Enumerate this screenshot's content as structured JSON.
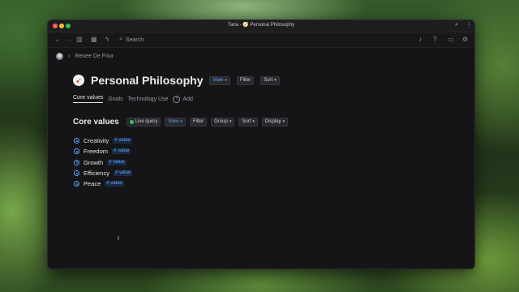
{
  "window": {
    "title": "Tana - 🧭 Personal Philosophy"
  },
  "toolbar": {
    "search_placeholder": "Search"
  },
  "breadcrumb": {
    "user": "Renee De Four"
  },
  "page": {
    "title": "Personal Philosophy",
    "chips": {
      "view": "View",
      "filter": "Filter",
      "sort": "Sort"
    }
  },
  "tabs": {
    "core": "Core values",
    "goals": "Goals",
    "tech": "Technology Use",
    "add": "Add"
  },
  "section": {
    "title": "Core values",
    "live": "Live query",
    "view": "View",
    "filter": "Filter",
    "group": "Group",
    "sort": "Sort",
    "display": "Display"
  },
  "items": [
    {
      "label": "Creativity",
      "tag": "# value"
    },
    {
      "label": "Freedom",
      "tag": "# value"
    },
    {
      "label": "Growth",
      "tag": "# value"
    },
    {
      "label": "Efficiency",
      "tag": "# value"
    },
    {
      "label": "Peace",
      "tag": "# value"
    }
  ],
  "colors": {
    "accent": "#5ba3ff",
    "live": "#38c46a",
    "background": "#151517"
  },
  "icons": [
    "back-arrow-icon",
    "forward-arrow-icon",
    "sidebar-icon",
    "calendar-icon",
    "lightning-icon",
    "search-icon",
    "bell-icon",
    "help-icon",
    "keyboard-icon",
    "settings-icon",
    "zoom-icon",
    "more-icon",
    "compass-icon"
  ]
}
